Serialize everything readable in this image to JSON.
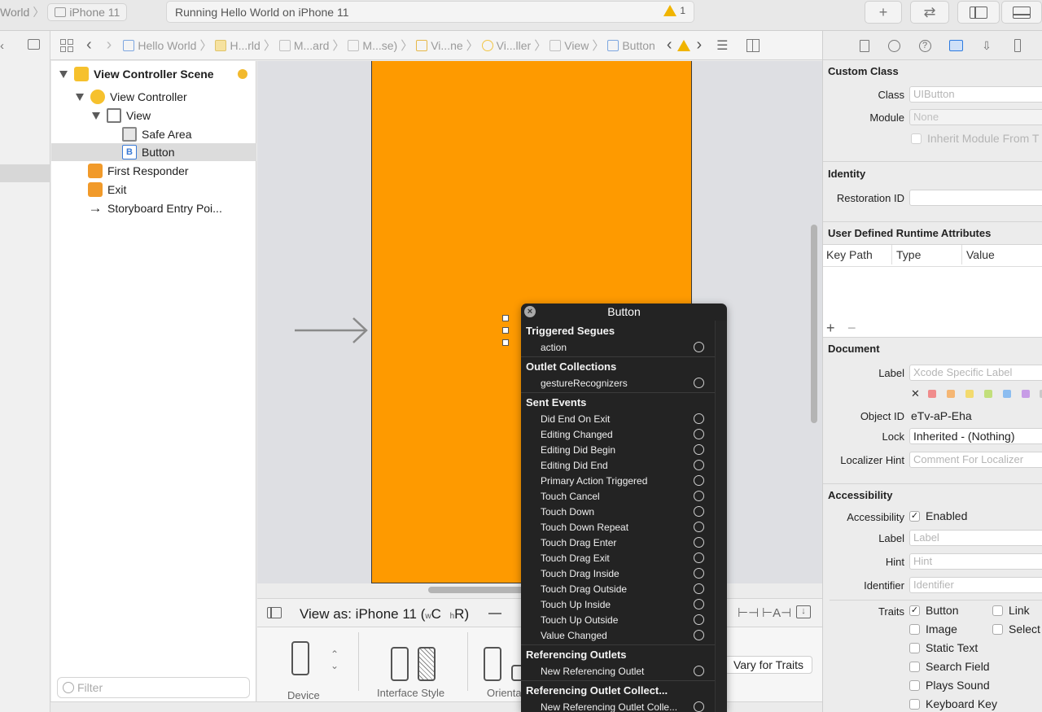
{
  "toolbar": {
    "scheme": "World",
    "device": "iPhone 11",
    "status": "Running Hello World on iPhone 11",
    "warning_count": "1"
  },
  "jumpbar": {
    "crumbs": [
      "Hello World",
      "H...rld",
      "M...ard",
      "M...se)",
      "Vi...ne",
      "Vi...ller",
      "View",
      "Button"
    ]
  },
  "outline": {
    "items": [
      {
        "label": "View Controller Scene"
      },
      {
        "label": "View Controller"
      },
      {
        "label": "View"
      },
      {
        "label": "Safe Area"
      },
      {
        "label": "Button",
        "icon_letter": "B"
      },
      {
        "label": "First Responder"
      },
      {
        "label": "Exit"
      },
      {
        "label": "Storyboard Entry Poi..."
      }
    ],
    "filter_placeholder": "Filter"
  },
  "canvas": {
    "view_as": "View as: iPhone 11 (",
    "size_w": "w",
    "size_c": "C",
    "size_h": "h",
    "size_r": "R)",
    "device_label": "Device",
    "interface_style_label": "Interface Style",
    "orientation_label": "Orienta",
    "vary_for_traits": "Vary for Traits"
  },
  "hud": {
    "title": "Button",
    "sections": [
      {
        "title": "Triggered Segues",
        "items": [
          "action"
        ]
      },
      {
        "title": "Outlet Collections",
        "items": [
          "gestureRecognizers"
        ]
      },
      {
        "title": "Sent Events",
        "items": [
          "Did End On Exit",
          "Editing Changed",
          "Editing Did Begin",
          "Editing Did End",
          "Primary Action Triggered",
          "Touch Cancel",
          "Touch Down",
          "Touch Down Repeat",
          "Touch Drag Enter",
          "Touch Drag Exit",
          "Touch Drag Inside",
          "Touch Drag Outside",
          "Touch Up Inside",
          "Touch Up Outside",
          "Value Changed"
        ]
      },
      {
        "title": "Referencing Outlets",
        "items": [
          "New Referencing Outlet"
        ]
      },
      {
        "title": "Referencing Outlet Collect...",
        "items": [
          "New Referencing Outlet Colle..."
        ]
      }
    ]
  },
  "inspector": {
    "custom_class": {
      "header": "Custom Class",
      "class_label": "Class",
      "class_placeholder": "UIButton",
      "module_label": "Module",
      "module_placeholder": "None",
      "inherit_label": "Inherit Module From T"
    },
    "identity": {
      "header": "Identity",
      "restoration_label": "Restoration ID"
    },
    "uda": {
      "header": "User Defined Runtime Attributes",
      "col_keypath": "Key Path",
      "col_type": "Type",
      "col_value": "Value",
      "add": "+",
      "remove": "−"
    },
    "document": {
      "header": "Document",
      "label_label": "Label",
      "label_placeholder": "Xcode Specific Label",
      "clear_color": "✕",
      "swatch_colors": [
        "#f08c8c",
        "#f5b673",
        "#f3da6e",
        "#c2df7b",
        "#8cbdf0",
        "#c79ce6",
        "#c9c9c9"
      ],
      "objectid_label": "Object ID",
      "objectid_value": "eTv-aP-Eha",
      "lock_label": "Lock",
      "lock_value": "Inherited - (Nothing)",
      "localizer_label": "Localizer Hint",
      "localizer_placeholder": "Comment For Localizer"
    },
    "accessibility": {
      "header": "Accessibility",
      "accessibility_label": "Accessibility",
      "enabled_label": "Enabled",
      "label_label": "Label",
      "label_placeholder": "Label",
      "hint_label": "Hint",
      "hint_placeholder": "Hint",
      "identifier_label": "Identifier",
      "identifier_placeholder": "Identifier",
      "traits_label": "Traits",
      "traits": [
        "Button",
        "Link",
        "Image",
        "Select",
        "Static Text",
        "Search Field",
        "Plays Sound",
        "Keyboard Key"
      ]
    }
  },
  "colors": {
    "canvas_view": "#fe9a00",
    "hud_bg": "#232323",
    "accent": "#2d7be0",
    "warning": "#f0b400"
  }
}
